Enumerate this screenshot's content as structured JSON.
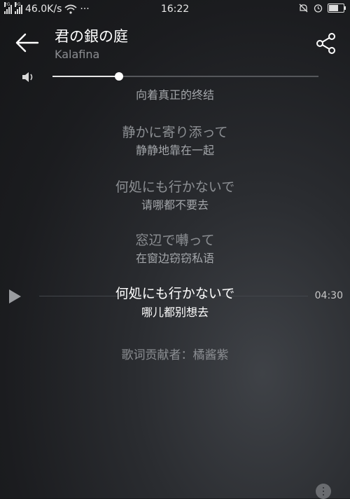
{
  "status_bar": {
    "signal1_tag": "2G",
    "signal2_tag": "4G",
    "net_speed": "46.0K/s",
    "more_dots": "···",
    "time": "16:22"
  },
  "header": {
    "title": "君の銀の庭",
    "artist": "Kalafina"
  },
  "volume": {
    "level": 0.25
  },
  "lyrics": [
    {
      "original": "",
      "translation": "向着真正的终结"
    },
    {
      "original": "静かに寄り添って",
      "translation": "静静地靠在一起"
    },
    {
      "original": "何処にも行かないで",
      "translation": "请哪都不要去"
    },
    {
      "original": "窓辺で囀って",
      "translation": "在窗边窃窃私语"
    },
    {
      "original": "何処にも行かないで",
      "translation": "哪儿都别想去"
    }
  ],
  "player": {
    "current_time": "04:30"
  },
  "contributor": "歌词贡献者：橘酱紫",
  "colors": {
    "accent": "#ffffff",
    "dim_text": "#8c8f93",
    "bg": "#1b1c1f"
  }
}
